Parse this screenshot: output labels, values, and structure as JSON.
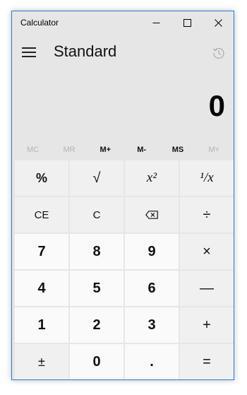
{
  "window": {
    "title": "Calculator"
  },
  "header": {
    "mode": "Standard"
  },
  "display": {
    "value": "0"
  },
  "memory": [
    {
      "label": "MC",
      "enabled": false
    },
    {
      "label": "MR",
      "enabled": false
    },
    {
      "label": "M+",
      "enabled": true
    },
    {
      "label": "M-",
      "enabled": true
    },
    {
      "label": "MS",
      "enabled": true
    },
    {
      "label": "M˅",
      "enabled": false
    }
  ],
  "keys": {
    "percent": "%",
    "sqrt": "√",
    "square": "x²",
    "reciprocal": "¹/x",
    "ce": "CE",
    "c": "C",
    "backspace": "⌫",
    "divide": "÷",
    "seven": "7",
    "eight": "8",
    "nine": "9",
    "multiply": "×",
    "four": "4",
    "five": "5",
    "six": "6",
    "minus": "—",
    "one": "1",
    "two": "2",
    "three": "3",
    "plus": "+",
    "negate": "±",
    "zero": "0",
    "decimal": ".",
    "equals": "="
  },
  "icons": {
    "minimize": "minimize-icon",
    "maximize": "maximize-icon",
    "close": "close-icon",
    "menu": "hamburger-icon",
    "history": "history-icon"
  }
}
